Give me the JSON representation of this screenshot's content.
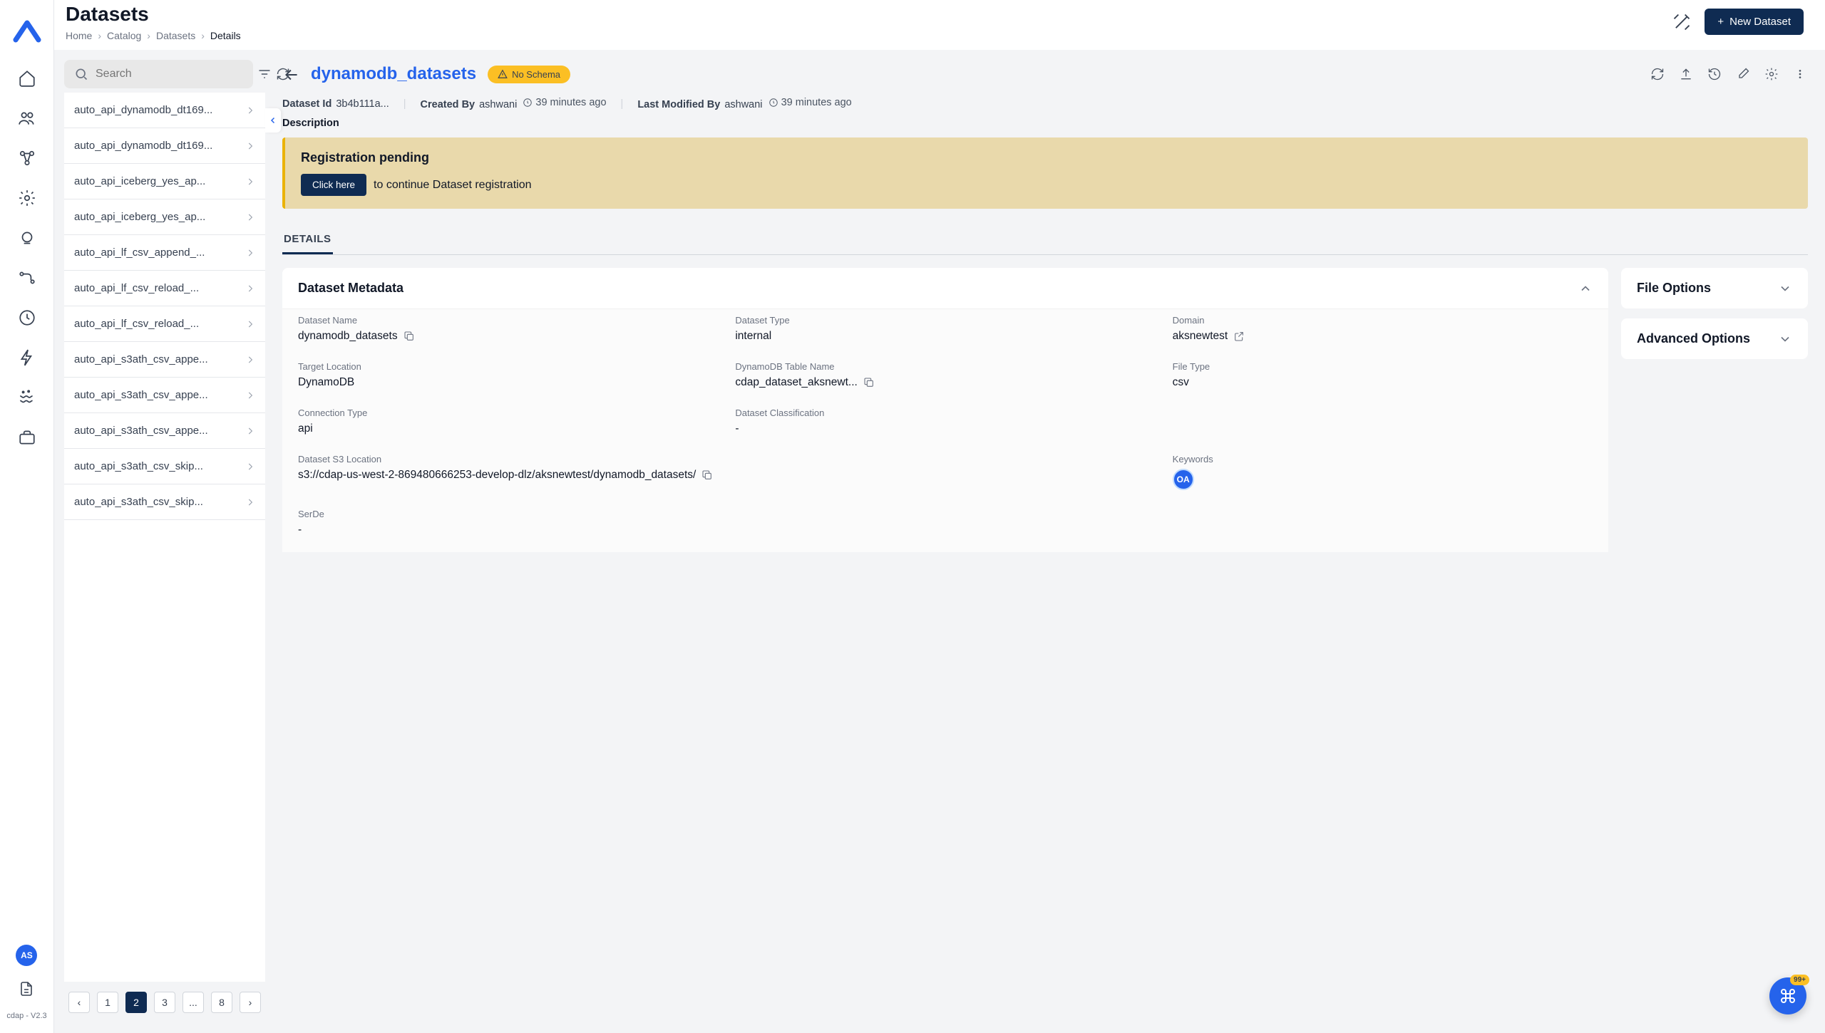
{
  "rail": {
    "avatar": "AS",
    "version": "cdap - V2.3"
  },
  "header": {
    "title": "Datasets",
    "breadcrumb": [
      "Home",
      "Catalog",
      "Datasets",
      "Details"
    ],
    "new_button": "New Dataset"
  },
  "sidebar": {
    "search_placeholder": "Search",
    "items": [
      "auto_api_dynamodb_dt169...",
      "auto_api_dynamodb_dt169...",
      "auto_api_iceberg_yes_ap...",
      "auto_api_iceberg_yes_ap...",
      "auto_api_lf_csv_append_...",
      "auto_api_lf_csv_reload_...",
      "auto_api_lf_csv_reload_...",
      "auto_api_s3ath_csv_appe...",
      "auto_api_s3ath_csv_appe...",
      "auto_api_s3ath_csv_appe...",
      "auto_api_s3ath_csv_skip...",
      "auto_api_s3ath_csv_skip..."
    ],
    "pages": [
      "1",
      "2",
      "3",
      "...",
      "8"
    ],
    "active_page": "2"
  },
  "detail": {
    "title": "dynamodb_datasets",
    "badge": "No Schema",
    "dataset_id_label": "Dataset Id",
    "dataset_id": "3b4b111a...",
    "created_by_label": "Created By",
    "created_by": "ashwani",
    "created_time": "39 minutes ago",
    "modified_by_label": "Last Modified By",
    "modified_by": "ashwani",
    "modified_time": "39 minutes ago",
    "description_label": "Description",
    "banner": {
      "title": "Registration pending",
      "button": "Click here",
      "text": "to continue Dataset registration"
    },
    "tabs": {
      "details": "DETAILS"
    },
    "cards": {
      "metadata": {
        "title": "Dataset Metadata",
        "fields": {
          "dataset_name": {
            "label": "Dataset Name",
            "value": "dynamodb_datasets"
          },
          "dataset_type": {
            "label": "Dataset Type",
            "value": "internal"
          },
          "domain": {
            "label": "Domain",
            "value": "aksnewtest"
          },
          "target_location": {
            "label": "Target Location",
            "value": "DynamoDB"
          },
          "table_name": {
            "label": "DynamoDB Table Name",
            "value": "cdap_dataset_aksnewt..."
          },
          "file_type": {
            "label": "File Type",
            "value": "csv"
          },
          "connection_type": {
            "label": "Connection Type",
            "value": "api"
          },
          "classification": {
            "label": "Dataset Classification",
            "value": "-"
          },
          "s3_location": {
            "label": "Dataset S3 Location",
            "value": "s3://cdap-us-west-2-869480666253-develop-dlz/aksnewtest/dynamodb_datasets/"
          },
          "keywords": {
            "label": "Keywords",
            "value": "OA"
          },
          "serde": {
            "label": "SerDe",
            "value": "-"
          }
        }
      },
      "file_options": {
        "title": "File Options"
      },
      "advanced": {
        "title": "Advanced Options"
      }
    }
  },
  "fab": {
    "badge": "99+"
  }
}
